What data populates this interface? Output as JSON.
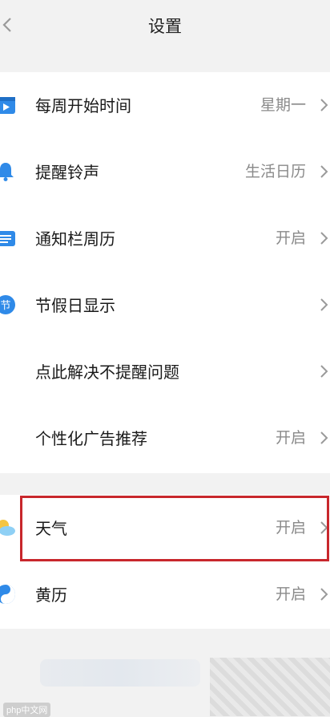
{
  "header": {
    "title": "设置"
  },
  "group1": [
    {
      "label": "每周开始时间",
      "value": "星期一",
      "icon": "calendar-play-icon"
    },
    {
      "label": "提醒铃声",
      "value": "生活日历",
      "icon": "bell-icon"
    },
    {
      "label": "通知栏周历",
      "value": "开启",
      "icon": "notification-calendar-icon"
    },
    {
      "label": "节假日显示",
      "value": "",
      "icon": "holiday-badge-icon",
      "badge_text": "节"
    },
    {
      "label": "点此解决不提醒问题",
      "value": ""
    },
    {
      "label": "个性化广告推荐",
      "value": "开启"
    }
  ],
  "group2": [
    {
      "label": "天气",
      "value": "开启",
      "icon": "weather-icon"
    },
    {
      "label": "黄历",
      "value": "开启",
      "icon": "yin-yang-icon"
    }
  ],
  "watermark": "php中文网",
  "colors": {
    "accent": "#2f8ae8",
    "highlight": "#c8272c"
  }
}
